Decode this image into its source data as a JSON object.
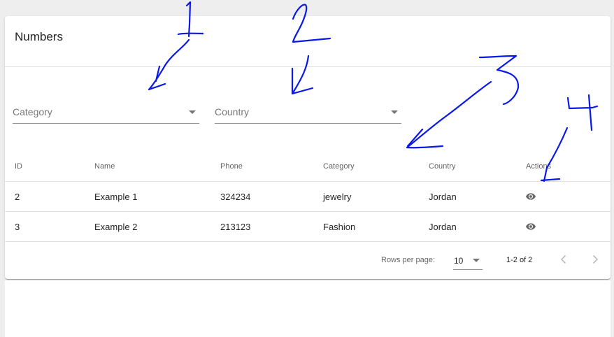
{
  "card": {
    "title": "Numbers"
  },
  "filters": {
    "category": {
      "placeholder": "Category"
    },
    "country": {
      "placeholder": "Country"
    }
  },
  "table": {
    "headers": [
      "ID",
      "Name",
      "Phone",
      "Category",
      "Country",
      "Actions"
    ],
    "rows": [
      {
        "id": "2",
        "name": "Example 1",
        "phone": "324234",
        "category": "jewelry",
        "country": "Jordan",
        "action_icon": "eye-icon"
      },
      {
        "id": "3",
        "name": "Example 2",
        "phone": "213123",
        "category": "Fashion",
        "country": "Jordan",
        "action_icon": "eye-icon"
      }
    ]
  },
  "pagination": {
    "rows_per_page_label": "Rows per page:",
    "rows_per_page_value": "10",
    "range_label": "1-2 of 2",
    "prev_icon": "chevron-left-icon",
    "next_icon": "chevron-right-icon"
  },
  "annotations": {
    "color": "#0a18e8",
    "numbers": [
      "1",
      "2",
      "3",
      "4"
    ]
  }
}
